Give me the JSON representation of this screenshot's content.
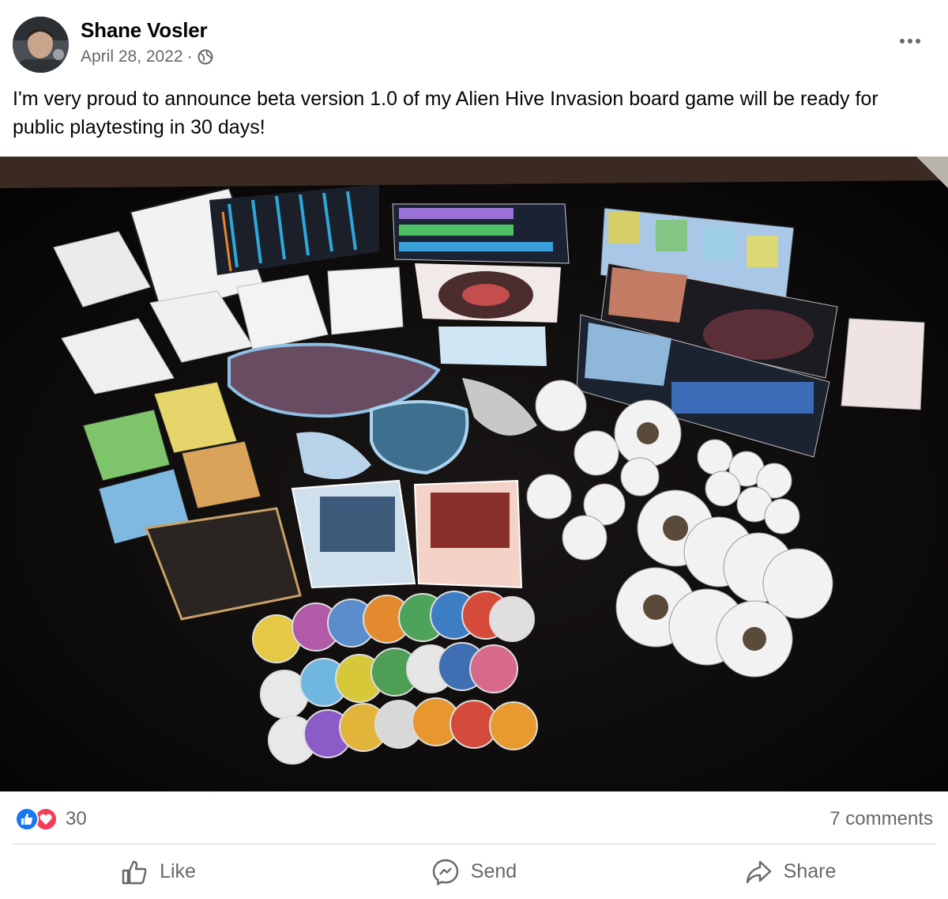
{
  "post": {
    "author": "Shane Vosler",
    "date": "April 28, 2022",
    "separator": "·",
    "audience_icon": "globe-icon",
    "text": "I'm very proud to announce beta version 1.0 of my Alien Hive Invasion board game will be ready for public playtesting in 30 days!"
  },
  "stats": {
    "reaction_icons": [
      "like-icon",
      "love-icon"
    ],
    "reaction_count": "30",
    "comments": "7 comments"
  },
  "actions": {
    "like": "Like",
    "send": "Send",
    "share": "Share"
  },
  "colors": {
    "facebook_blue": "#1877f2",
    "love_red": "#f33e58",
    "secondary_text": "#65676b"
  }
}
